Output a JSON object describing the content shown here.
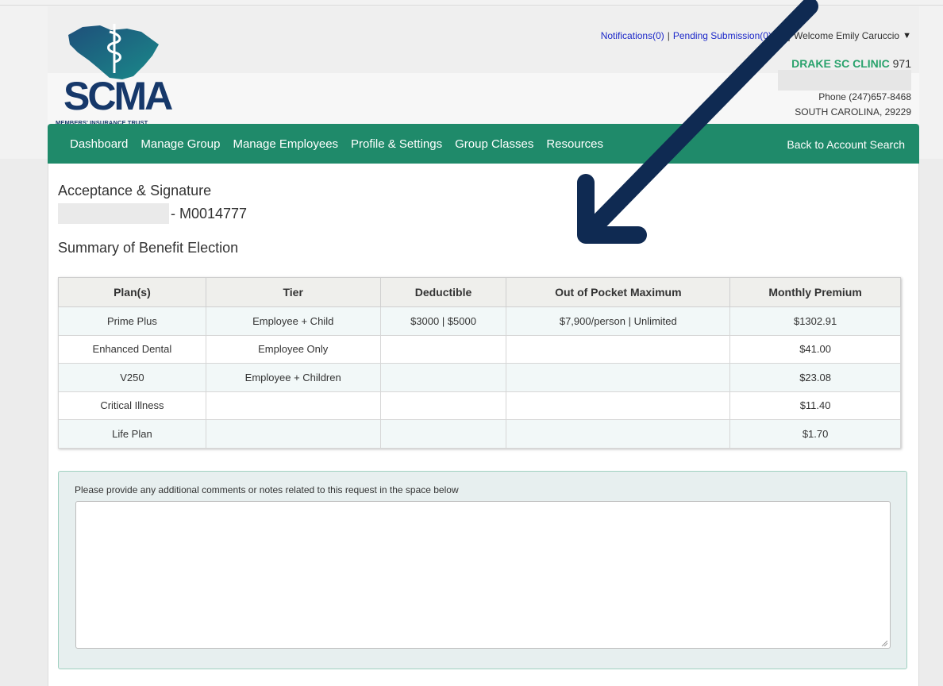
{
  "brand": {
    "logo_text": "SCMA",
    "logo_subtext": "MEMBERS' INSURANCE TRUST",
    "colors": {
      "navy": "#16386a",
      "teal": "#1f8a6a",
      "green": "#2aa36d",
      "link": "#1c28c9"
    }
  },
  "topbar": {
    "notifications": "Notifications(0)",
    "separator": "|",
    "pending": "Pending Submission(0)",
    "user_icon": "user-icon",
    "welcome": "Welcome Emily Caruccio",
    "caret": "▼"
  },
  "clinic": {
    "name": "DRAKE SC CLINIC",
    "number": "971",
    "phone": "Phone (247)657-8468",
    "address": "SOUTH CAROLINA, 29229"
  },
  "nav": {
    "items": [
      "Dashboard",
      "Manage Group",
      "Manage Employees",
      "Profile & Settings",
      "Group Classes",
      "Resources"
    ],
    "back": "Back to Account Search"
  },
  "page": {
    "title": "Acceptance & Signature",
    "member_id": "- M0014777",
    "summary_title": "Summary of Benefit Election"
  },
  "table": {
    "headers": [
      "Plan(s)",
      "Tier",
      "Deductible",
      "Out of Pocket Maximum",
      "Monthly Premium"
    ],
    "rows": [
      [
        "Prime Plus",
        "Employee + Child",
        "$3000 | $5000",
        "$7,900/person | Unlimited",
        "$1302.91"
      ],
      [
        "Enhanced Dental",
        "Employee Only",
        "",
        "",
        "$41.00"
      ],
      [
        "V250",
        "Employee + Children",
        "",
        "",
        "$23.08"
      ],
      [
        "Critical Illness",
        "",
        "",
        "",
        "$11.40"
      ],
      [
        "Life Plan",
        "",
        "",
        "",
        "$1.70"
      ]
    ]
  },
  "comments": {
    "label": "Please provide any additional comments or notes related to this request in the space below",
    "value": ""
  }
}
